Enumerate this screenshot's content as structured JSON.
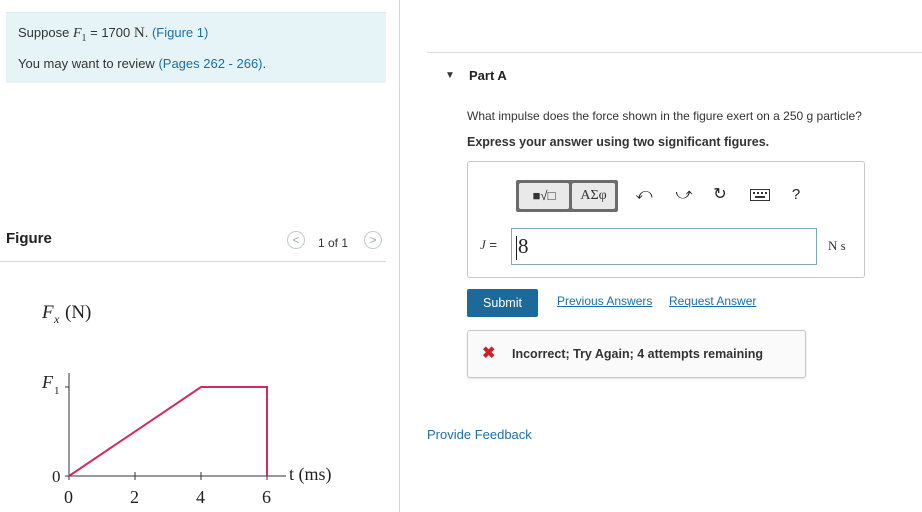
{
  "intro": {
    "suppose_prefix": "Suppose",
    "var_F": "F",
    "var_sub": "1",
    "equals_value": " = 1700",
    "unit_N": "N",
    "figure_link": "(Figure 1)",
    "review_prefix": "You may want to review",
    "pages_link": "(Pages 262 - 266)",
    "review_suffix": "."
  },
  "figure_panel": {
    "title": "Figure",
    "pager": "1 of 1",
    "prev_glyph": "<",
    "next_glyph": ">"
  },
  "graph": {
    "y_label_var": "F",
    "y_label_sub": "x",
    "y_label_unit": "(N)",
    "f1_var": "F",
    "f1_sub": "1",
    "zero_label": "0",
    "x_label": "t (ms)",
    "x_ticks": [
      "0",
      "2",
      "4",
      "6"
    ],
    "line_color": "#d42a5c"
  },
  "chart_data": {
    "type": "line",
    "x": [
      0,
      4,
      6,
      6
    ],
    "y": [
      "0",
      "F1",
      "F1",
      "0"
    ],
    "xlabel": "t (ms)",
    "ylabel": "Fx (N)",
    "x_ticks": [
      0,
      2,
      4,
      6
    ],
    "y_ticks": [
      "0",
      "F1"
    ]
  },
  "part": {
    "label": "Part A",
    "question": "What impulse does the force shown in the figure exert on a 250 g particle?",
    "instruction": "Express your answer using two significant figures."
  },
  "toolbar": {
    "templates_label": "■√□",
    "greek_label": "ΑΣφ",
    "undo_icon": "undo-icon",
    "redo_icon": "redo-icon",
    "reset_icon": "reset-icon",
    "keyboard_icon": "keyboard-icon",
    "help_label": "?"
  },
  "answer": {
    "var_label": "J",
    "equals": " =",
    "value": "8",
    "unit": "N s"
  },
  "actions": {
    "submit": "Submit",
    "previous_answers": "Previous Answers",
    "request_answer": "Request Answer"
  },
  "feedback": {
    "message": "Incorrect; Try Again; 4 attempts remaining",
    "color": "#d32027"
  },
  "footer": {
    "provide_feedback": "Provide Feedback"
  },
  "colors": {
    "link": "#1b6fa8",
    "submit_bg": "#1d6a9a",
    "intro_bg": "#e6f4f7"
  }
}
